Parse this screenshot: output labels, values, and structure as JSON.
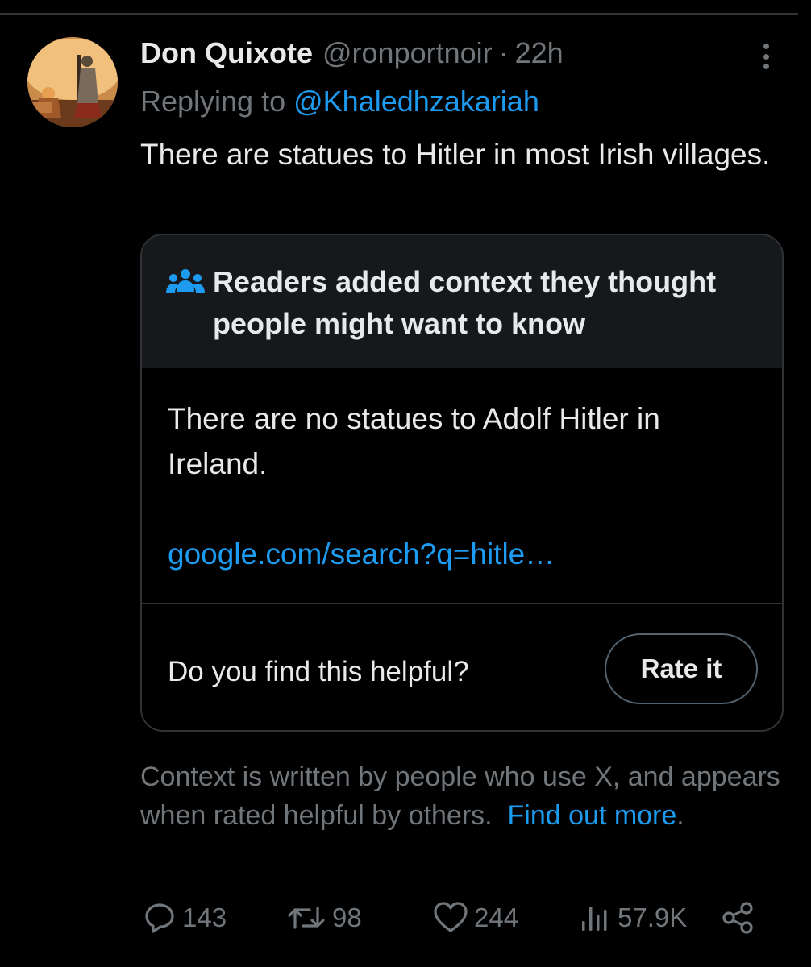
{
  "tweet": {
    "display_name": "Don Quixote",
    "handle": "@ronportnoir",
    "separator": "·",
    "time": "22h",
    "replying_prefix": "Replying to",
    "replying_to": "@Khaledhzakariah",
    "text": "There are statues to Hitler in most Irish villages."
  },
  "community_note": {
    "title": "Readers added context they thought people might want to know",
    "body": "There are no statues to Adolf Hitler in Ireland.",
    "link": "google.com/search?q=hitle…",
    "helpful_question": "Do you find this helpful?",
    "rate_button": "Rate it"
  },
  "context_info": {
    "text": "Context is written by people who use X, and appears when rated helpful by others.",
    "link": "Find out more",
    "trailing": "."
  },
  "actions": {
    "replies": "143",
    "reposts": "98",
    "likes": "244",
    "views": "57.9K"
  },
  "icons": {
    "more": "more-vertical-icon",
    "note": "people-icon",
    "reply": "reply-icon",
    "repost": "repost-icon",
    "like": "heart-icon",
    "views": "views-icon",
    "share": "share-icon"
  },
  "colors": {
    "background": "#000000",
    "text_primary": "#e7e9ea",
    "text_secondary": "#71767b",
    "accent": "#1d9bf0",
    "border": "#2f3336",
    "note_header_bg": "#16181c"
  }
}
